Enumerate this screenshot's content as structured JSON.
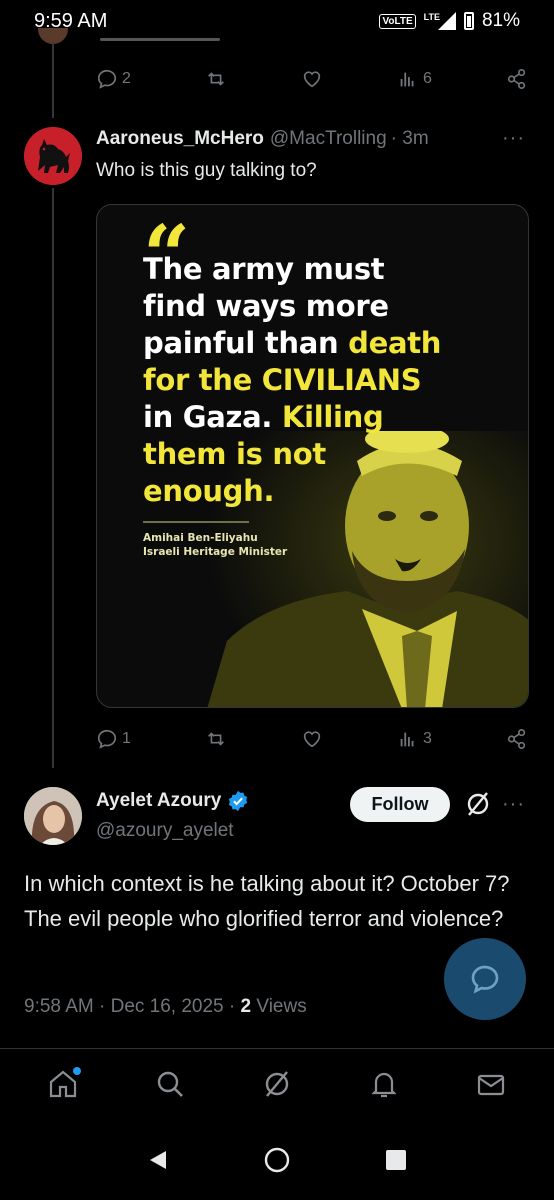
{
  "status_bar": {
    "time": "9:59 AM",
    "volte": "VoLTE",
    "network": "LTE",
    "battery": "81%"
  },
  "prev_tweet_actions": {
    "replies": "2",
    "views": "6"
  },
  "tweet1": {
    "display_name": "Aaroneus_McHero",
    "handle": "@MacTrolling",
    "time": "· 3m",
    "text": "Who is this guy talking to?",
    "media": {
      "quote_mark": "“",
      "quote_parts": [
        {
          "text": "The army must find ways more painful than ",
          "highlight": false
        },
        {
          "text": "death for the CIVILIANS",
          "highlight": true
        },
        {
          "text": " in Gaza. ",
          "highlight": false
        },
        {
          "text": "Killing them is not enough.",
          "highlight": true
        }
      ],
      "quote_white_1": "The army must",
      "quote_white_2": "find ways more",
      "quote_white_3": "painful than ",
      "quote_yellow_1": "death",
      "quote_yellow_2": "for the CIVILIANS",
      "quote_white_4": "in Gaza. ",
      "quote_yellow_3": "Killing",
      "quote_yellow_4": "them is not",
      "quote_yellow_5": "enough.",
      "attribution_name": "Amihai Ben-Eliyahu",
      "attribution_title": "Israeli Heritage Minister",
      "highlight_color": "#f2e63a"
    },
    "actions": {
      "replies": "1",
      "views": "3"
    }
  },
  "tweet2": {
    "display_name": "Ayelet Azoury",
    "handle": "@azoury_ayelet",
    "follow_label": "Follow",
    "text": "In which context is he talking about it? October 7? The evil people who glorified terror and violence?",
    "timestamp": "9:58 AM · Dec 16, 2025 · ",
    "views_count": "2",
    "views_label": " Views"
  },
  "colors": {
    "background": "#000000",
    "text_primary": "#e7e9ea",
    "text_secondary": "#71767b",
    "verified": "#1d9bf0",
    "fab": "#1a4a6e"
  },
  "bottom_nav": {
    "items": [
      "home-icon",
      "grok-icon",
      "communities-icon",
      "notifications-icon",
      "messages-icon"
    ]
  }
}
